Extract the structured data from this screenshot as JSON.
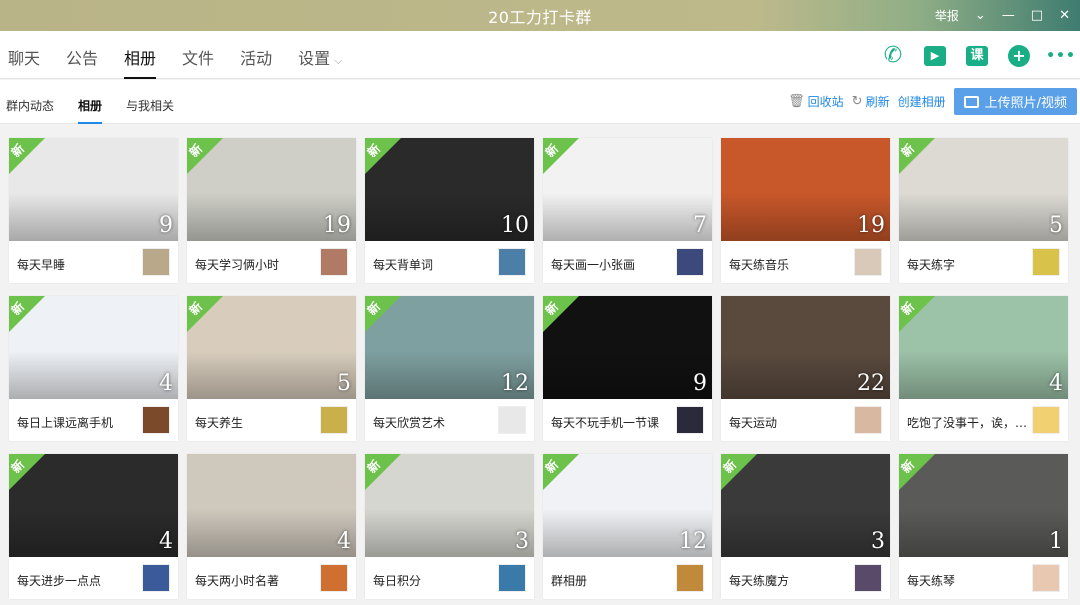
{
  "window": {
    "title": "20工力打卡群",
    "report_label": "举报",
    "controls": [
      "⌄",
      "—",
      "□",
      "✕"
    ]
  },
  "main_tabs": [
    {
      "label": "聊天"
    },
    {
      "label": "公告"
    },
    {
      "label": "相册",
      "active": true
    },
    {
      "label": "文件"
    },
    {
      "label": "活动"
    },
    {
      "label": "设置",
      "dropdown": true
    }
  ],
  "tools": [
    {
      "icon": "phone-icon",
      "glyph": "✆"
    },
    {
      "icon": "video-icon",
      "glyph": "▶"
    },
    {
      "icon": "course-icon",
      "glyph": "课"
    },
    {
      "icon": "add-icon",
      "glyph": "+"
    },
    {
      "icon": "more-icon",
      "glyph": "•••"
    }
  ],
  "sub_tabs": [
    {
      "label": "群内动态"
    },
    {
      "label": "相册",
      "active": true
    },
    {
      "label": "与我相关"
    }
  ],
  "actions": {
    "recycle": "回收站",
    "refresh": "刷新",
    "create": "创建相册",
    "upload": "上传照片/视频"
  },
  "new_badge": "新",
  "albums": [
    {
      "name": "每天早睡",
      "count": "9",
      "new": true,
      "thumb": "#e8e8e8",
      "avatar": "#b9a98a"
    },
    {
      "name": "每天学习俩小时",
      "count": "19",
      "new": true,
      "thumb": "#cfcfc8",
      "avatar": "#b07a64"
    },
    {
      "name": "每天背单词",
      "count": "10",
      "new": true,
      "thumb": "#2a2a2a",
      "avatar": "#4b7fa8"
    },
    {
      "name": "每天画一小张画",
      "count": "7",
      "new": true,
      "thumb": "#f2f2f2",
      "avatar": "#3b4a7a"
    },
    {
      "name": "每天练音乐",
      "count": "19",
      "new": false,
      "thumb": "#c8572a",
      "avatar": "#d9c9b8"
    },
    {
      "name": "每天练字",
      "count": "5",
      "new": true,
      "thumb": "#dcdad3",
      "avatar": "#d8c24a"
    },
    {
      "name": "每日上课远离手机",
      "count": "4",
      "new": true,
      "thumb": "#eef1f5",
      "avatar": "#7a4a2a"
    },
    {
      "name": "每天养生",
      "count": "5",
      "new": true,
      "thumb": "#d8cdbd",
      "avatar": "#c9b04a"
    },
    {
      "name": "每天欣赏艺术",
      "count": "12",
      "new": true,
      "thumb": "#7fa0a0",
      "avatar": "#e8e8e8"
    },
    {
      "name": "每天不玩手机一节课",
      "count": "9",
      "new": true,
      "thumb": "#111111",
      "avatar": "#2a2a3a"
    },
    {
      "name": "每天运动",
      "count": "22",
      "new": false,
      "thumb": "#5a4a3e",
      "avatar": "#d8b8a0"
    },
    {
      "name": "吃饱了没事干，诶，…",
      "count": "4",
      "new": true,
      "thumb": "#9cc2a8",
      "avatar": "#f0d070"
    },
    {
      "name": "每天进步一点点",
      "count": "4",
      "new": true,
      "thumb": "#2b2b2b",
      "avatar": "#3a5a9a"
    },
    {
      "name": "每天两小时名著",
      "count": "4",
      "new": false,
      "thumb": "#cfc8bd",
      "avatar": "#d07030"
    },
    {
      "name": "每日积分",
      "count": "3",
      "new": true,
      "thumb": "#d6d6d0",
      "avatar": "#3a7aa8"
    },
    {
      "name": "群相册",
      "count": "12",
      "new": true,
      "thumb": "#f0f2f5",
      "avatar": "#c08a3a"
    },
    {
      "name": "每天练魔方",
      "count": "3",
      "new": true,
      "thumb": "#3a3a3a",
      "avatar": "#5a4a6a"
    },
    {
      "name": "每天练琴",
      "count": "1",
      "new": true,
      "thumb": "#5a5a58",
      "avatar": "#e8c8b0"
    }
  ]
}
